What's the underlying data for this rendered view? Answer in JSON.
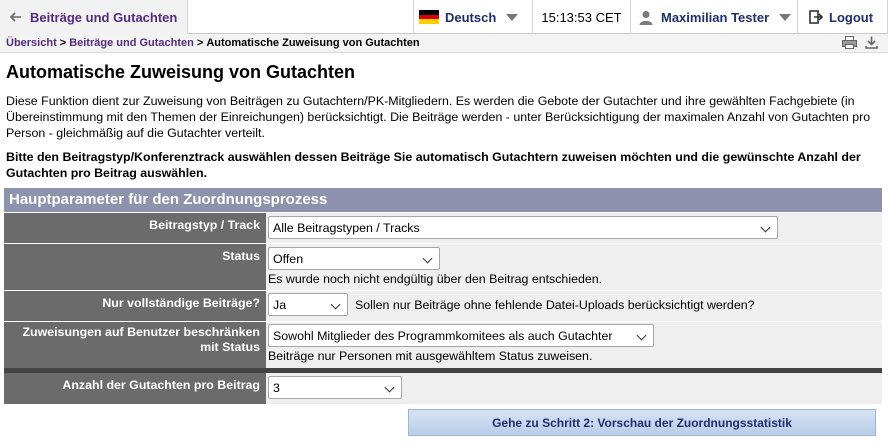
{
  "topbar": {
    "back_label": "Beiträge und Gutachten",
    "language": "Deutsch",
    "time": "15:13:53",
    "timezone": "CET",
    "user": "Maximilian Tester",
    "logout": "Logout"
  },
  "breadcrumb": {
    "items": [
      "Übersicht",
      "Beiträge und Gutachten"
    ],
    "current": "Automatische Zuweisung von Gutachten"
  },
  "page": {
    "title": "Automatische Zuweisung von Gutachten",
    "intro": "Diese Funktion dient zur Zuweisung von Beiträgen zu Gutachtern/PK-Mitgliedern. Es werden die Gebote der Gutachter und ihre gewählten Fachgebiete (in Übereinstimmung mit den Themen der Einreichungen) berücksichtigt. Die Beiträge werden - unter Berücksichtigung der maximalen Anzahl von Gutachten pro Person - gleichmäßig auf die Gutachter verteilt.",
    "instruction": "Bitte den Beitragstyp/Konferenztrack auswählen dessen Beiträge Sie automatisch Gutachtern zuweisen möchten und die gewünschte Anzahl der Gutachten pro Beitrag auswählen."
  },
  "form": {
    "section_title": "Hauptparameter für den Zuordnungsprozess",
    "track": {
      "label": "Beitragstyp / Track",
      "value": "Alle Beitragstypen / Tracks"
    },
    "status": {
      "label": "Status",
      "value": "Offen",
      "hint": "Es wurde noch nicht endgültig über den Beitrag entschieden."
    },
    "complete": {
      "label": "Nur vollständige Beiträge?",
      "value": "Ja",
      "hint": "Sollen nur Beiträge ohne fehlende Datei-Uploads berücksichtigt werden?"
    },
    "restrict": {
      "label": "Zuweisungen auf Benutzer beschränken mit Status",
      "value": "Sowohl Mitglieder des Programmkomitees als auch Gutachter",
      "hint": "Beiträge nur Personen mit ausgewähltem Status zuweisen."
    },
    "count": {
      "label": "Anzahl der Gutachten pro Beitrag",
      "value": "3"
    },
    "next_button": "Gehe zu Schritt 2: Vorschau der Zuordnungsstatistik"
  },
  "colors": {
    "section_header": "#8d93ad",
    "label_bg": "#6b6b6b",
    "link": "#552b7d",
    "accent_text": "#1f2e6e"
  }
}
